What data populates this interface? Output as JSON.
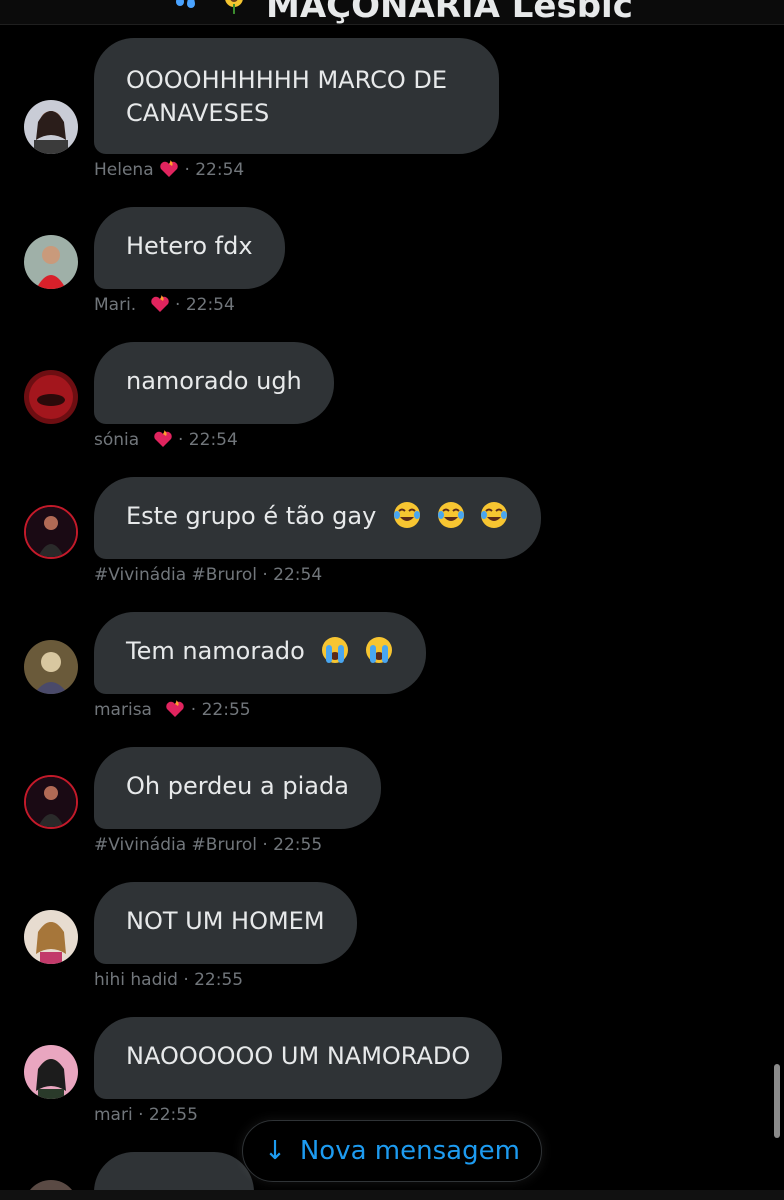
{
  "header": {
    "title": "MAÇONARIA Lésbic"
  },
  "messages": [
    {
      "text_line1": "OOOOHHHHHH MARCO DE",
      "text_line2": "CANAVESES",
      "sender": "Helena",
      "time": "· 22:54",
      "heart": true
    },
    {
      "text": "Hetero fdx",
      "sender": "Mari.",
      "time": "· 22:54",
      "heart": true
    },
    {
      "text": "namorado ugh",
      "sender": "sónia",
      "time": "· 22:54",
      "heart": true
    },
    {
      "text": "Este grupo é tão gay",
      "emojis": [
        "tears-of-joy-emoji",
        "tears-of-joy-emoji",
        "tears-of-joy-emoji"
      ],
      "sender": "#Vivinádia #Brurol",
      "time": "· 22:54",
      "heart": false
    },
    {
      "text": "Tem namorado",
      "emojis": [
        "loudly-crying-emoji",
        "loudly-crying-emoji"
      ],
      "sender": "marisa",
      "time": "· 22:55",
      "heart": true
    },
    {
      "text": "Oh perdeu a piada",
      "sender": "#Vivinádia #Brurol",
      "time": "· 22:55",
      "heart": false
    },
    {
      "text": "NOT UM HOMEM",
      "sender": "hihi hadid",
      "time": "· 22:55",
      "heart": false
    },
    {
      "text": "NAOOOOOO UM NAMORADO",
      "sender": "mari",
      "time": "· 22:55",
      "heart": false
    }
  ],
  "new_message_button": {
    "label": "Nova mensagem",
    "icon": "arrow-down-icon"
  },
  "colors": {
    "background": "#000000",
    "bubble": "#2f3336",
    "text": "#e7e9ea",
    "meta": "#71767b",
    "accent": "#1d9bf0"
  }
}
